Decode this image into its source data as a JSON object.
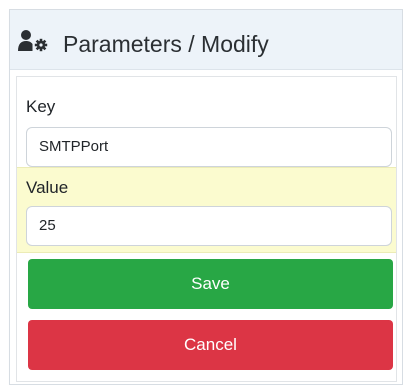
{
  "header": {
    "title": "Parameters / Modify",
    "icon": "users-cog-icon"
  },
  "form": {
    "key_label": "Key",
    "key_value": "SMTPPort",
    "value_label": "Value",
    "value_value": "25"
  },
  "actions": {
    "save_label": "Save",
    "cancel_label": "Cancel"
  },
  "colors": {
    "header_bg": "#edf3f9",
    "value_highlight": "#fbfbcf",
    "save": "#28a745",
    "cancel": "#dc3545"
  }
}
